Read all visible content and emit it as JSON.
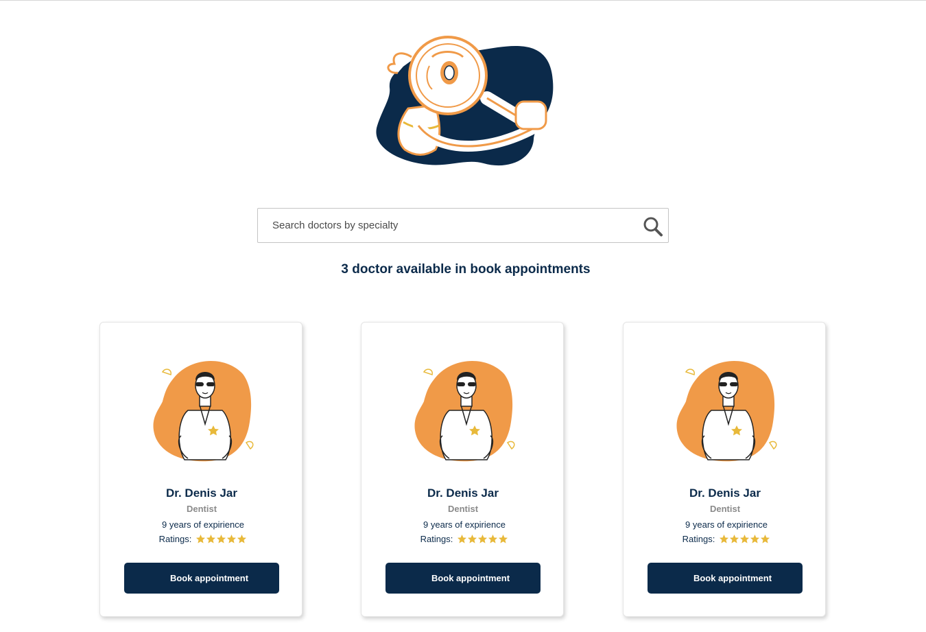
{
  "search": {
    "placeholder": "Search doctors by specialty",
    "icon": "search-icon"
  },
  "headline": "3 doctor available in book appointments",
  "colors": {
    "navy": "#0b2a4a",
    "orange": "#f09a48",
    "gold": "#e8b93a"
  },
  "doctors": [
    {
      "name": "Dr. Denis Jar",
      "specialty": "Dentist",
      "experience": "9 years of expirience",
      "ratings_label": "Ratings:",
      "rating": 5,
      "button": "Book appointment"
    },
    {
      "name": "Dr. Denis Jar",
      "specialty": "Dentist",
      "experience": "9 years of expirience",
      "ratings_label": "Ratings:",
      "rating": 5,
      "button": "Book appointment"
    },
    {
      "name": "Dr. Denis Jar",
      "specialty": "Dentist",
      "experience": "9 years of expirience",
      "ratings_label": "Ratings:",
      "rating": 5,
      "button": "Book appointment"
    }
  ]
}
